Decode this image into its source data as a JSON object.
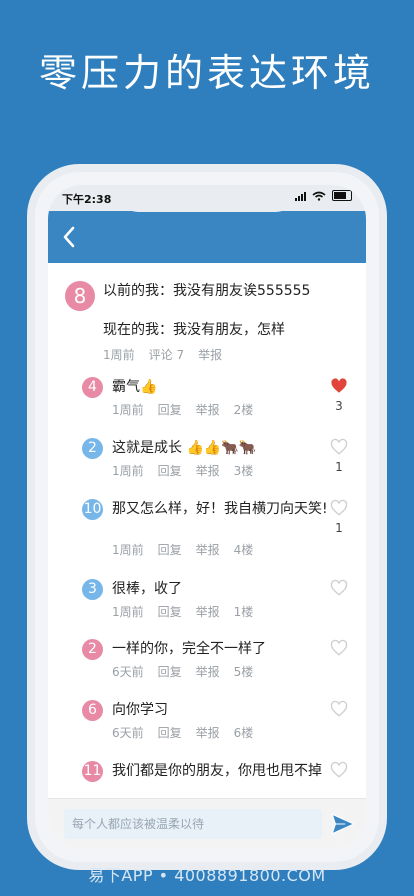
{
  "headline": "零压力的表达环境",
  "status": {
    "time": "下午2:38"
  },
  "post": {
    "badge": "8",
    "line1": "以前的我：我没有朋友诶555555",
    "line2": "现在的我：我没有朋友，怎样",
    "time": "1周前",
    "comments": "评论 7",
    "report": "举报"
  },
  "comments": [
    {
      "badge": "4",
      "color": "pink",
      "text": "霸气👍",
      "time": "1周前",
      "reply": "回复",
      "report": "举报",
      "floor": "2楼",
      "likes": "3",
      "liked": true
    },
    {
      "badge": "2",
      "color": "blue",
      "text": "这就是成长 👍👍🐂🐂",
      "time": "1周前",
      "reply": "回复",
      "report": "举报",
      "floor": "3楼",
      "likes": "1",
      "liked": false
    },
    {
      "badge": "10",
      "color": "blue",
      "text": "那又怎么样，好！我自横刀向天笑!",
      "time": "1周前",
      "reply": "回复",
      "report": "举报",
      "floor": "4楼",
      "likes": "1",
      "liked": false
    },
    {
      "badge": "3",
      "color": "blue",
      "text": "很棒，收了",
      "time": "1周前",
      "reply": "回复",
      "report": "举报",
      "floor": "1楼",
      "likes": "",
      "liked": false
    },
    {
      "badge": "2",
      "color": "pink",
      "text": "一样的你，完全不一样了",
      "time": "6天前",
      "reply": "回复",
      "report": "举报",
      "floor": "5楼",
      "likes": "",
      "liked": false
    },
    {
      "badge": "6",
      "color": "pink",
      "text": "向你学习",
      "time": "6天前",
      "reply": "回复",
      "report": "举报",
      "floor": "6楼",
      "likes": "",
      "liked": false
    },
    {
      "badge": "11",
      "color": "pink",
      "text": "我们都是你的朋友，你甩也甩不掉",
      "time": "",
      "reply": "",
      "report": "",
      "floor": "",
      "likes": "",
      "liked": false
    }
  ],
  "input": {
    "placeholder": "每个人都应该被温柔以待"
  },
  "watermark": "易下APP • 4008891800.COM",
  "colors": {
    "nav": "#3a86c3",
    "background": "#2f7fbe",
    "heart_active": "#e0443a",
    "heart_inactive": "#cfcfcf"
  }
}
